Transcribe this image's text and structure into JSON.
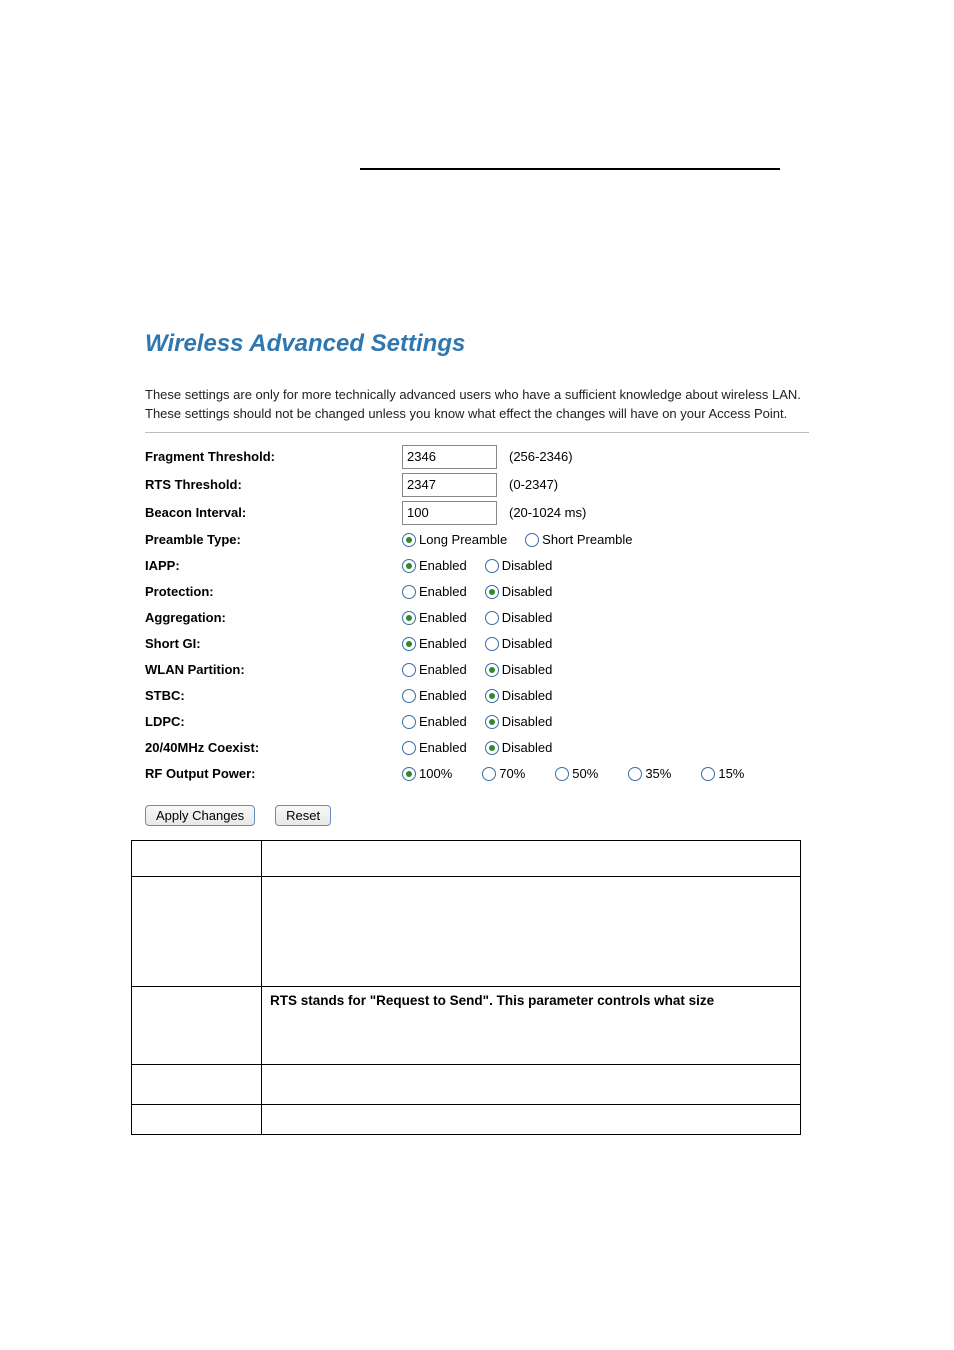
{
  "title": "Wireless Advanced Settings",
  "description": "These settings are only for more technically advanced users who have a sufficient knowledge about wireless LAN. These settings should not be changed unless you know what effect the changes will have on your Access Point.",
  "fields": {
    "frag": {
      "label": "Fragment Threshold:",
      "value": "2346",
      "hint": "(256-2346)"
    },
    "rts": {
      "label": "RTS Threshold:",
      "value": "2347",
      "hint": "(0-2347)"
    },
    "beacon": {
      "label": "Beacon Interval:",
      "value": "100",
      "hint": "(20-1024 ms)"
    },
    "preamble": {
      "label": "Preamble Type:",
      "opts": [
        "Long Preamble",
        "Short Preamble"
      ],
      "selected": 0
    },
    "iapp": {
      "label": "IAPP:",
      "opts": [
        "Enabled",
        "Disabled"
      ],
      "selected": 0
    },
    "protection": {
      "label": "Protection:",
      "opts": [
        "Enabled",
        "Disabled"
      ],
      "selected": 1
    },
    "aggregation": {
      "label": "Aggregation:",
      "opts": [
        "Enabled",
        "Disabled"
      ],
      "selected": 0
    },
    "shortgi": {
      "label": "Short GI:",
      "opts": [
        "Enabled",
        "Disabled"
      ],
      "selected": 0
    },
    "wlanpart": {
      "label": "WLAN Partition:",
      "opts": [
        "Enabled",
        "Disabled"
      ],
      "selected": 1
    },
    "stbc": {
      "label": "STBC:",
      "opts": [
        "Enabled",
        "Disabled"
      ],
      "selected": 1
    },
    "ldpc": {
      "label": "LDPC:",
      "opts": [
        "Enabled",
        "Disabled"
      ],
      "selected": 1
    },
    "coexist": {
      "label": "20/40MHz Coexist:",
      "opts": [
        "Enabled",
        "Disabled"
      ],
      "selected": 1
    },
    "rfpower": {
      "label": "RF Output Power:",
      "opts": [
        "100%",
        "70%",
        "50%",
        "35%",
        "15%"
      ],
      "selected": 0
    }
  },
  "buttons": {
    "apply": "Apply Changes",
    "reset": "Reset"
  },
  "info_table": {
    "row3": "RTS stands for \"Request to Send\". This parameter controls what size"
  }
}
